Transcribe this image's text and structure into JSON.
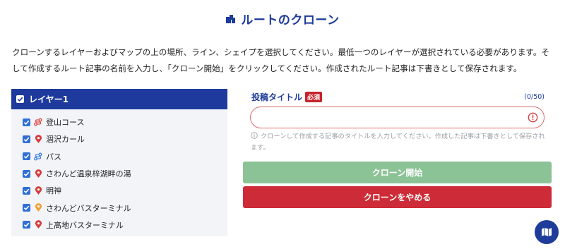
{
  "page": {
    "title": "ルートのクローン",
    "description": "クローンするレイヤーおよびマップの上の場所、ライン、シェイプを選択してください。最低一つのレイヤーが選択されている必要があります。そして作成するルート記事の名前を入力し、「クローン開始」をクリックしてください。作成されたルート記事は下書きとして保存されます。"
  },
  "layers": {
    "header": {
      "label": "レイヤー1",
      "checked": true
    },
    "items": [
      {
        "label": "登山コース",
        "icon": "route-line-icon",
        "checked": true
      },
      {
        "label": "涸沢カール",
        "icon": "map-pin-icon",
        "checked": true
      },
      {
        "label": "パス",
        "icon": "route-line-icon",
        "checked": true
      },
      {
        "label": "さわんど温泉梓湖畔の湯",
        "icon": "map-pin-icon",
        "checked": true
      },
      {
        "label": "明神",
        "icon": "map-pin-icon",
        "checked": true
      },
      {
        "label": "さわんどバスターミナル",
        "icon": "map-pin-icon",
        "checked": true
      },
      {
        "label": "上高地バスターミナル",
        "icon": "map-pin-icon",
        "checked": true
      }
    ]
  },
  "form": {
    "label": "投稿タイトル",
    "required_badge": "必須",
    "char_count": "(0/50)",
    "input_value": "",
    "hint": "クローンして作成する記事のタイトルを入力してください。作成した記事は下書きとして保存されます。"
  },
  "buttons": {
    "start": "クローン開始",
    "cancel": "クローンをやめる"
  },
  "colors": {
    "accent": "#1e3a9c",
    "start_button": "#8cc396",
    "cancel_button": "#cd2b37",
    "pin_red": "#d63a3a",
    "pin_orange": "#f0a132",
    "route_red": "#e0443c",
    "route_blue": "#3f7fe0",
    "error": "#e06b6b"
  }
}
